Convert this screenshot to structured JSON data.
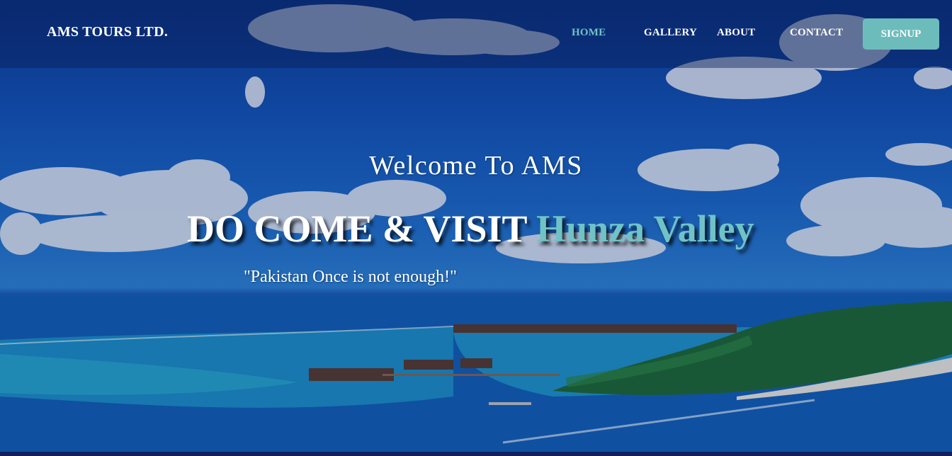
{
  "brand": {
    "name": "AMS TOURS LTD."
  },
  "nav": {
    "items": [
      {
        "label": "HOME",
        "active": true
      },
      {
        "label": "GALLERY",
        "active": false
      },
      {
        "label": "ABOUT",
        "active": false
      },
      {
        "label": "CONTACT",
        "active": false
      }
    ],
    "signup_label": "SIGNUP"
  },
  "hero": {
    "welcome": "Welcome To AMS",
    "headline_prefix": "DO COME & VISIT",
    "headline_accent": "Hunza Valley",
    "tagline": "\"Pakistan Once is not enough!\""
  },
  "colors": {
    "accent": "#6fc3c7",
    "signup_bg": "#6dbcbc",
    "navbar_bg": "rgba(8,30,90,0.45)",
    "sky": "#1456b8",
    "lagoon": "#1aa0c9"
  }
}
